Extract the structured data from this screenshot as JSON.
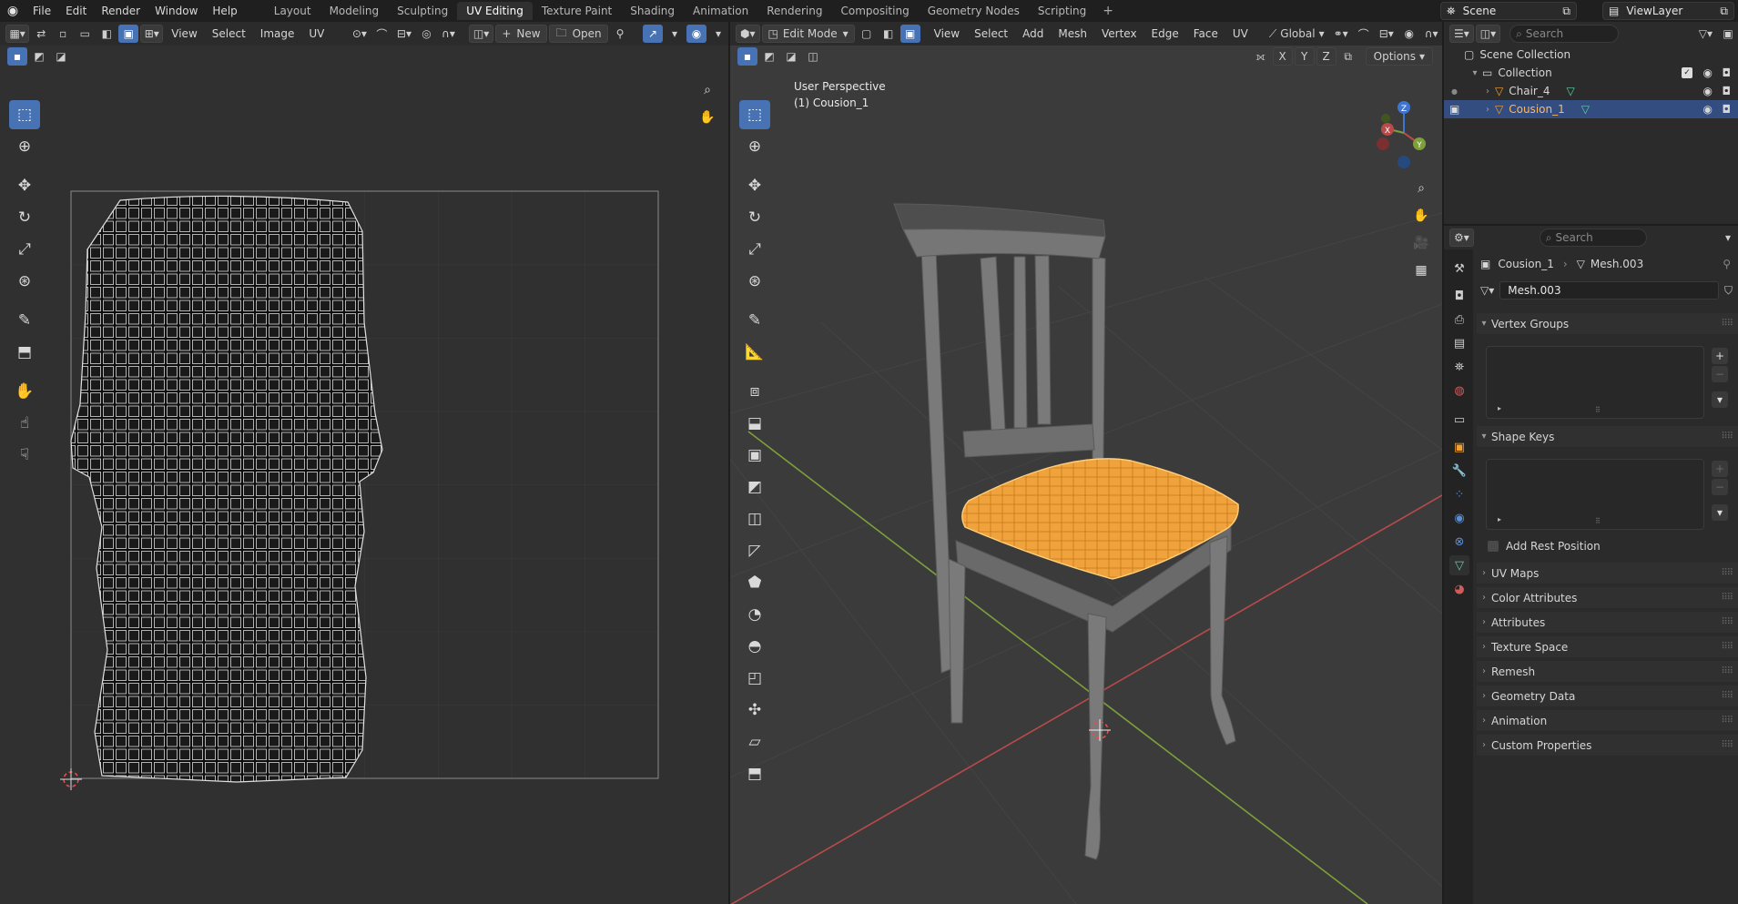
{
  "topbar": {
    "menus": [
      "File",
      "Edit",
      "Render",
      "Window",
      "Help"
    ],
    "workspaces": [
      "Layout",
      "Modeling",
      "Sculpting",
      "UV Editing",
      "Texture Paint",
      "Shading",
      "Animation",
      "Rendering",
      "Compositing",
      "Geometry Nodes",
      "Scripting"
    ],
    "active_workspace": "UV Editing",
    "scene": "Scene",
    "view_layer": "ViewLayer"
  },
  "uv_editor": {
    "menus": [
      "View",
      "Select",
      "Image",
      "UV"
    ],
    "new_label": "New",
    "open_label": "Open"
  },
  "viewport": {
    "mode": "Edit Mode",
    "menus": [
      "View",
      "Select",
      "Add",
      "Mesh",
      "Vertex",
      "Edge",
      "Face",
      "UV"
    ],
    "transform_orientation": "Global",
    "axes": [
      "X",
      "Y",
      "Z"
    ],
    "options_label": "Options",
    "overlay_line1": "User Perspective",
    "overlay_line2": "(1) Cousion_1",
    "gizmo": {
      "x": "X",
      "y": "Y",
      "z": "Z"
    }
  },
  "outliner": {
    "search_placeholder": "Search",
    "scene_collection": "Scene Collection",
    "collection": "Collection",
    "items": [
      "Chair_4",
      "Cousion_1"
    ]
  },
  "properties": {
    "search_placeholder": "Search",
    "breadcrumb_object": "Cousion_1",
    "breadcrumb_mesh": "Mesh.003",
    "mesh_name": "Mesh.003",
    "vertex_groups": "Vertex Groups",
    "shape_keys": "Shape Keys",
    "add_rest_position": "Add Rest Position",
    "sections": [
      "UV Maps",
      "Color Attributes",
      "Attributes",
      "Texture Space",
      "Remesh",
      "Geometry Data",
      "Animation",
      "Custom Properties"
    ]
  },
  "colors": {
    "accent": "#4772b3",
    "selection_orange": "#f5a02c",
    "x_axis": "#b84a4a",
    "y_axis": "#7da03a",
    "z_axis": "#3f75d1"
  }
}
